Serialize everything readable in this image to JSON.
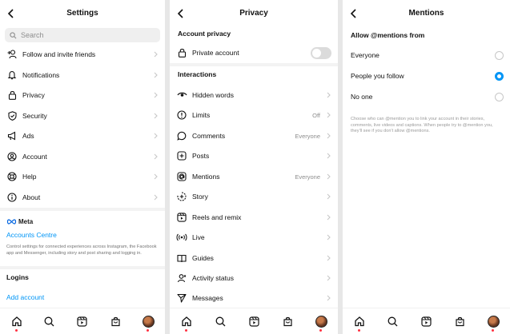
{
  "settings": {
    "title": "Settings",
    "search_placeholder": "Search",
    "items": [
      {
        "label": "Follow and invite friends",
        "icon": "add-person-icon"
      },
      {
        "label": "Notifications",
        "icon": "bell-icon"
      },
      {
        "label": "Privacy",
        "icon": "lock-icon"
      },
      {
        "label": "Security",
        "icon": "shield-icon"
      },
      {
        "label": "Ads",
        "icon": "megaphone-icon"
      },
      {
        "label": "Account",
        "icon": "account-icon"
      },
      {
        "label": "Help",
        "icon": "lifebuoy-icon"
      },
      {
        "label": "About",
        "icon": "info-icon"
      }
    ],
    "meta_label": "Meta",
    "accounts_centre": "Accounts Centre",
    "accounts_desc": "Control settings for connected experiences across Instagram, the Facebook app and Messenger, including story and post sharing and logging in.",
    "logins_header": "Logins",
    "add_account": "Add account"
  },
  "privacy": {
    "title": "Privacy",
    "account_privacy_header": "Account privacy",
    "private_account_label": "Private account",
    "private_account_on": false,
    "interactions_header": "Interactions",
    "items": [
      {
        "label": "Hidden words",
        "value": "",
        "icon": "eye-icon"
      },
      {
        "label": "Limits",
        "value": "Off",
        "icon": "alert-circle-icon"
      },
      {
        "label": "Comments",
        "value": "Everyone",
        "icon": "comment-icon"
      },
      {
        "label": "Posts",
        "value": "",
        "icon": "plus-square-icon"
      },
      {
        "label": "Mentions",
        "value": "Everyone",
        "icon": "at-icon"
      },
      {
        "label": "Story",
        "value": "",
        "icon": "story-icon"
      },
      {
        "label": "Reels and remix",
        "value": "",
        "icon": "reels-icon"
      },
      {
        "label": "Live",
        "value": "",
        "icon": "live-icon"
      },
      {
        "label": "Guides",
        "value": "",
        "icon": "guides-icon"
      },
      {
        "label": "Activity status",
        "value": "",
        "icon": "activity-icon"
      },
      {
        "label": "Messages",
        "value": "",
        "icon": "send-icon"
      }
    ]
  },
  "mentions": {
    "title": "Mentions",
    "header": "Allow @mentions from",
    "options": [
      {
        "label": "Everyone",
        "selected": false
      },
      {
        "label": "People you follow",
        "selected": true
      },
      {
        "label": "No one",
        "selected": false
      }
    ],
    "help_text": "Choose who can @mention you to link your account in their stories, comments, live videos and captions. When people try to @mention you, they'll see if you don't allow @mentions."
  },
  "tabbar": {
    "tabs": [
      "home-icon",
      "search-icon",
      "reels-icon",
      "shop-icon",
      "profile-avatar"
    ],
    "accent": "#ff3040"
  },
  "colors": {
    "link": "#0095f6",
    "secondary": "#8e8e8e"
  }
}
